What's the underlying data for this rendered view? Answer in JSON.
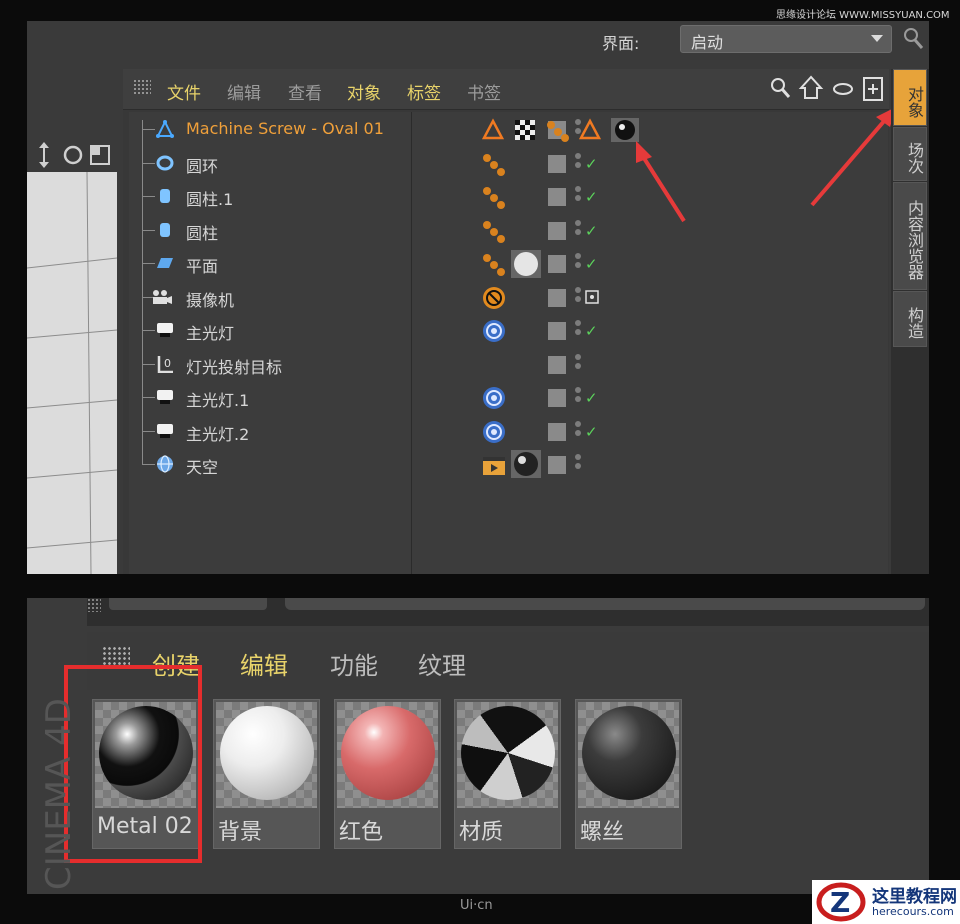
{
  "watermark": "思缘设计论坛 WWW.MISSYUAN.COM",
  "header": {
    "layout_label": "界面:",
    "layout_value": "启动"
  },
  "object_manager": {
    "menu": [
      "文件",
      "编辑",
      "查看",
      "对象",
      "标签",
      "书签"
    ],
    "objects": [
      {
        "name": "Machine Screw - Oval 01",
        "icon": "polygon-object-icon",
        "selected": true,
        "check": false
      },
      {
        "name": "圆环",
        "icon": "torus-icon",
        "selected": false,
        "check": true
      },
      {
        "name": "圆柱.1",
        "icon": "cylinder-icon",
        "selected": false,
        "check": true
      },
      {
        "name": "圆柱",
        "icon": "cylinder-icon",
        "selected": false,
        "check": true
      },
      {
        "name": "平面",
        "icon": "plane-icon",
        "selected": false,
        "check": true
      },
      {
        "name": "摄像机",
        "icon": "camera-icon",
        "selected": false,
        "check": false
      },
      {
        "name": "主光灯",
        "icon": "light-icon",
        "selected": false,
        "check": true
      },
      {
        "name": "灯光投射目标",
        "icon": "null-target-icon",
        "selected": false,
        "check": false
      },
      {
        "name": "主光灯.1",
        "icon": "light-icon",
        "selected": false,
        "check": true
      },
      {
        "name": "主光灯.2",
        "icon": "light-icon",
        "selected": false,
        "check": true
      },
      {
        "name": "天空",
        "icon": "sky-icon",
        "selected": false,
        "check": false
      }
    ],
    "side_tabs": [
      "对象",
      "场次",
      "内容浏览器",
      "构造"
    ]
  },
  "material_manager": {
    "menu": [
      "创建",
      "编辑",
      "功能",
      "纹理"
    ],
    "materials": [
      {
        "name": "Metal 02",
        "color": "#1a1a1a"
      },
      {
        "name": "背景",
        "color": "#e6e6e6"
      },
      {
        "name": "红色",
        "color": "#d86a6a"
      },
      {
        "name": "材质",
        "color": "#9a9a9a"
      },
      {
        "name": "螺丝",
        "color": "#3a3a3a"
      }
    ]
  },
  "brand_vertical": "CINEMA 4D",
  "footer": {
    "logo": "Ui·cn",
    "badge_title": "这里教程网",
    "badge_url": "herecours.com"
  },
  "colors": {
    "accent_orange": "#f0a03a",
    "menu_yellow": "#e8d36a",
    "highlight_red": "#e52d2d",
    "check_green": "#5bd05b"
  }
}
